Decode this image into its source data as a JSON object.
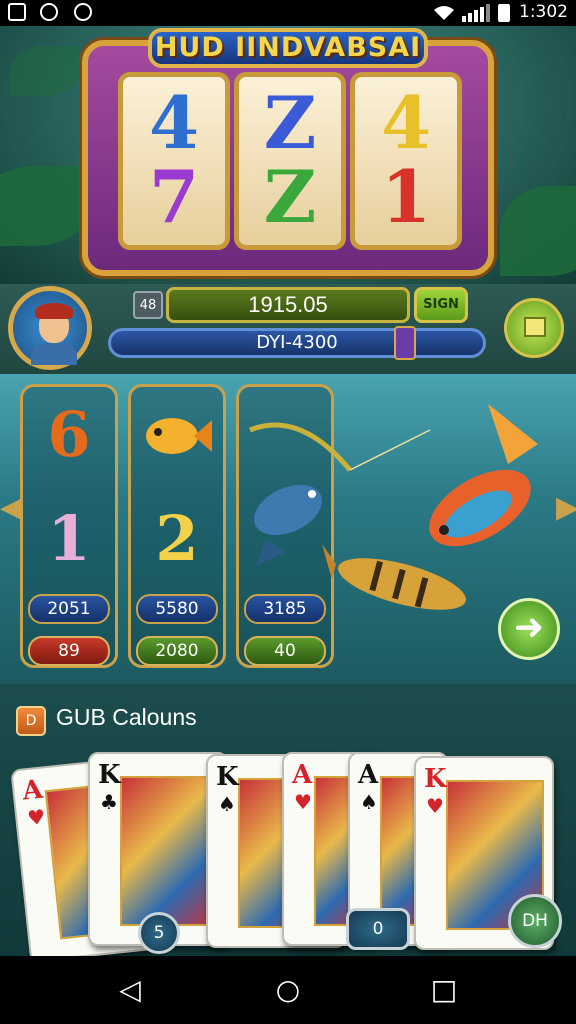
{
  "status_bar": {
    "time": "1:302",
    "icons": [
      "photo-icon",
      "chat-bubble-icon",
      "shield-icon",
      "wifi-icon",
      "signal-icon",
      "battery-icon"
    ]
  },
  "slot": {
    "title": "HUD IINDVABSAI",
    "reels": [
      {
        "top": "4",
        "bottom": "7"
      },
      {
        "top": "Z",
        "bottom": "Z"
      },
      {
        "top": "4",
        "bottom": "1"
      }
    ],
    "reel_colors": [
      {
        "top": "#2f6fd0",
        "bottom": "#9b3ad0"
      },
      {
        "top": "#3a5ad8",
        "bottom": "#3aa83a"
      },
      {
        "top": "#e8c02a",
        "bottom": "#d8322a"
      }
    ]
  },
  "controls": {
    "bet_chip": "48",
    "credit": "1915.05",
    "spin_label": "SIGN",
    "win_amount": "DYI-4300"
  },
  "fish_columns": [
    {
      "big_symbol": "6",
      "big_color": "#e56a1a",
      "mid_symbol": "1",
      "mid_color": "#e8b0d8",
      "value": "2051",
      "bet": "89",
      "bet_style": "red"
    },
    {
      "big_symbol": "",
      "big_color": "#f3b12e",
      "mid_symbol": "2",
      "mid_color": "#f3d24a",
      "value": "5580",
      "bet": "2080",
      "bet_style": "green"
    },
    {
      "big_symbol": "",
      "big_color": "#3d7ab0",
      "mid_symbol": "",
      "mid_color": "#3d7ab0",
      "value": "3185",
      "bet": "40",
      "bet_style": "green"
    }
  ],
  "cards_section": {
    "title": "GUB Calouns",
    "title_icon": "D",
    "cards": [
      {
        "rank": "A",
        "suit": "♥",
        "color": "red"
      },
      {
        "rank": "K",
        "suit": "♣",
        "color": "black"
      },
      {
        "rank": "K",
        "suit": "♠",
        "color": "black"
      },
      {
        "rank": "A",
        "suit": "♥",
        "color": "red"
      },
      {
        "rank": "A",
        "suit": "♠",
        "color": "black"
      },
      {
        "rank": "K",
        "suit": "♥",
        "color": "red"
      }
    ],
    "chip_left": "5",
    "chip_mid": "0",
    "chip_right": "DH"
  },
  "nav": {
    "back": "◁",
    "home": "○",
    "recents": "□"
  }
}
